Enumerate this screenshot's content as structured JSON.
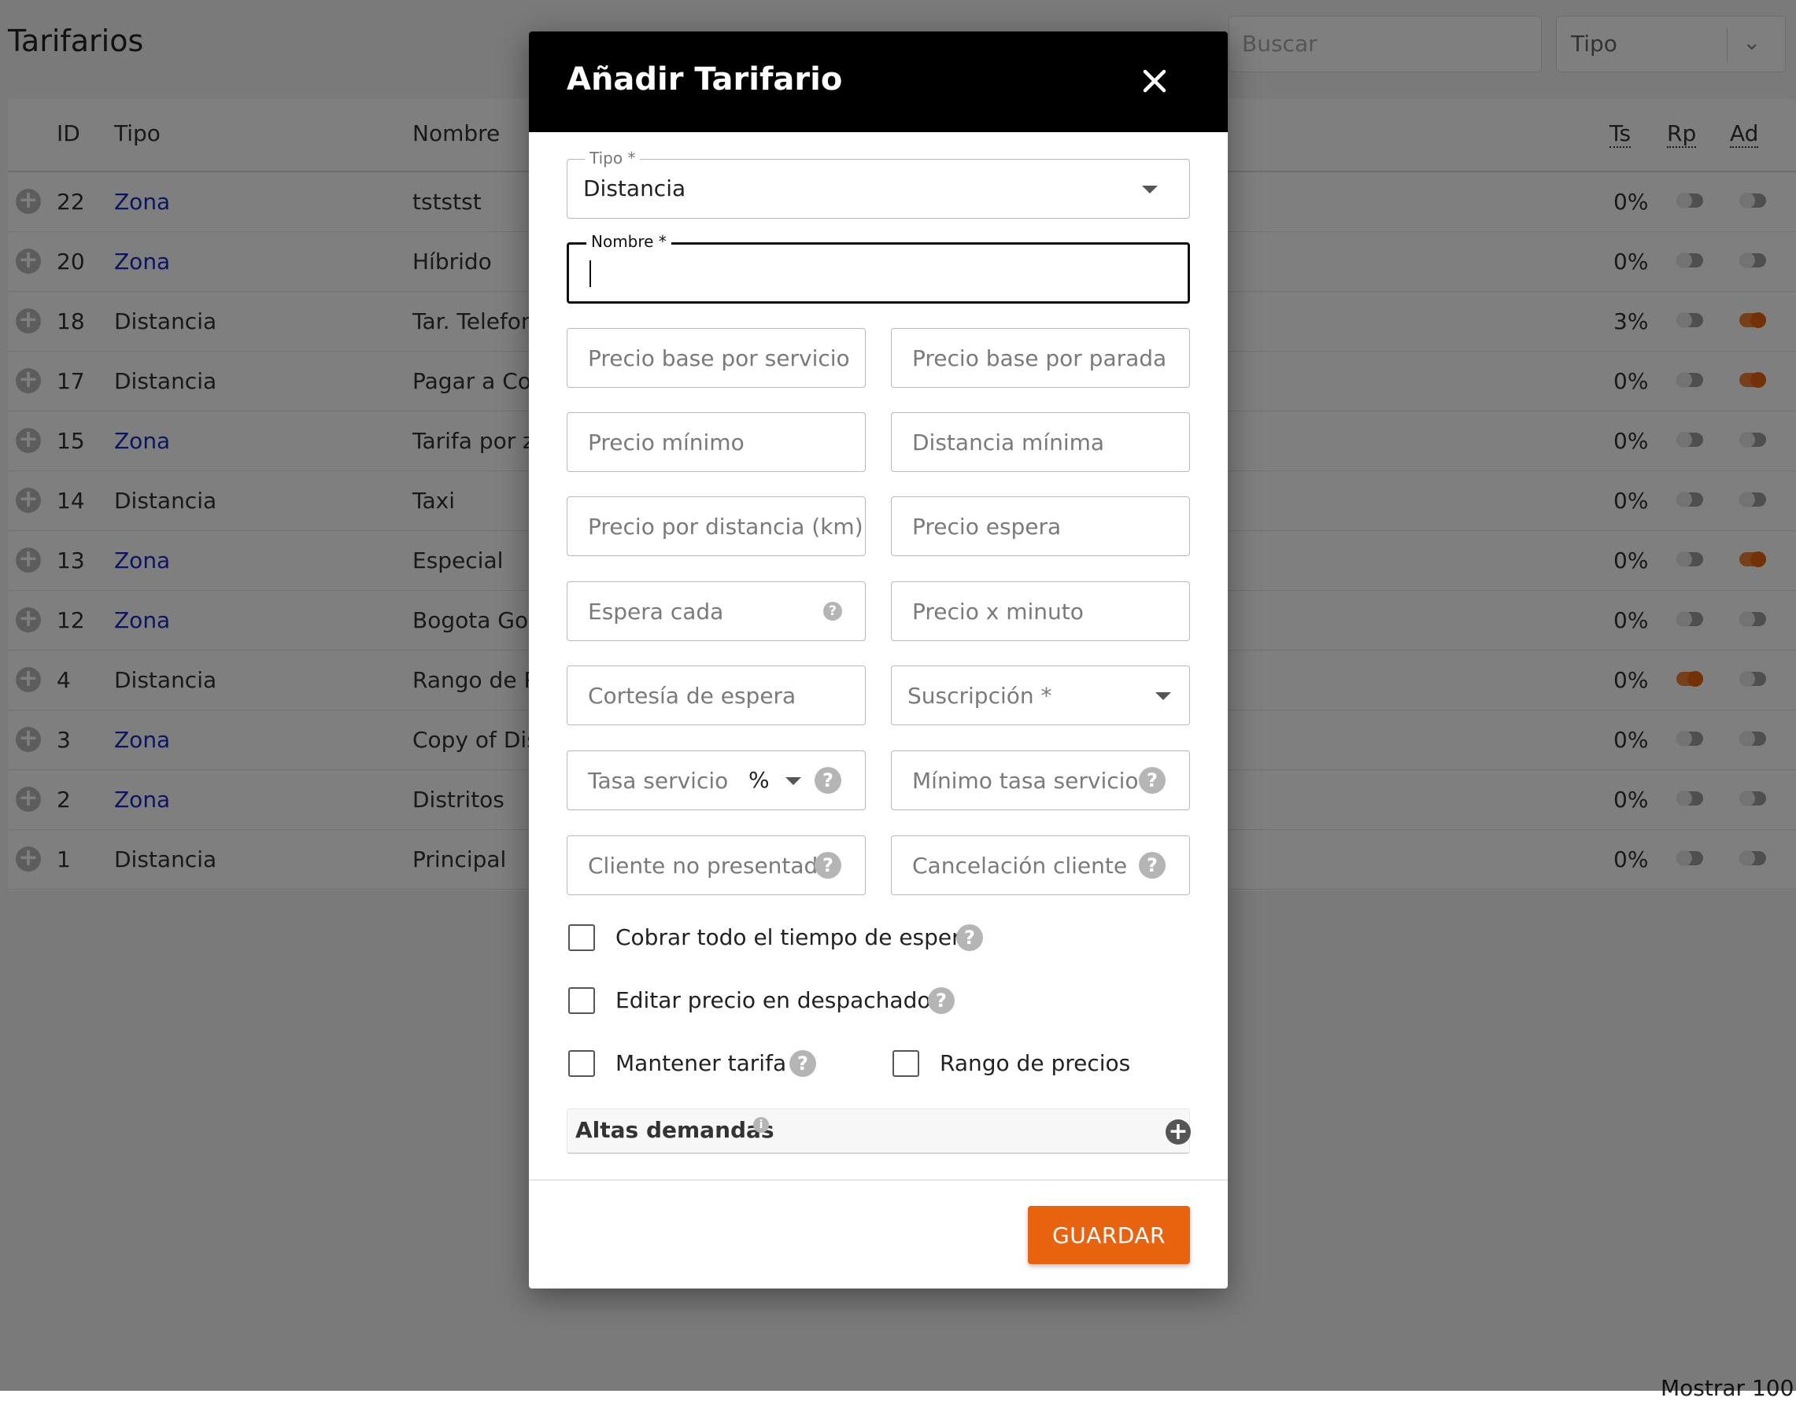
{
  "page": {
    "title": "Tarifarios",
    "search_placeholder": "Buscar",
    "tipo_filter": "Tipo",
    "footer": "Mostrar 100"
  },
  "table": {
    "headers": {
      "id": "ID",
      "tipo": "Tipo",
      "nombre": "Nombre",
      "ts": "Ts",
      "rp": "Rp",
      "ad": "Ad"
    },
    "rows": [
      {
        "id": "22",
        "tipo": "Zona",
        "nombre": "tststst",
        "pct": "0%",
        "rp": false,
        "ad": false
      },
      {
        "id": "20",
        "tipo": "Zona",
        "nombre": "Híbrido",
        "pct": "0%",
        "rp": false,
        "ad": false
      },
      {
        "id": "18",
        "tipo": "Distancia",
        "nombre": "Tar. Telefon",
        "pct": "3%",
        "rp": false,
        "ad": true
      },
      {
        "id": "17",
        "tipo": "Distancia",
        "nombre": "Pagar a Co",
        "pct": "0%",
        "rp": false,
        "ad": true
      },
      {
        "id": "15",
        "tipo": "Zona",
        "nombre": "Tarifa por z",
        "pct": "0%",
        "rp": false,
        "ad": false
      },
      {
        "id": "14",
        "tipo": "Distancia",
        "nombre": "Taxi",
        "pct": "0%",
        "rp": false,
        "ad": false
      },
      {
        "id": "13",
        "tipo": "Zona",
        "nombre": "Especial",
        "pct": "0%",
        "rp": false,
        "ad": true
      },
      {
        "id": "12",
        "tipo": "Zona",
        "nombre": "Bogota Go",
        "pct": "0%",
        "rp": false,
        "ad": false
      },
      {
        "id": "4",
        "tipo": "Distancia",
        "nombre": "Rango de P",
        "pct": "0%",
        "rp": true,
        "ad": false
      },
      {
        "id": "3",
        "tipo": "Zona",
        "nombre": "Copy of Dis",
        "pct": "0%",
        "rp": false,
        "ad": false
      },
      {
        "id": "2",
        "tipo": "Zona",
        "nombre": "Distritos",
        "pct": "0%",
        "rp": false,
        "ad": false
      },
      {
        "id": "1",
        "tipo": "Distancia",
        "nombre": "Principal",
        "pct": "0%",
        "rp": false,
        "ad": false
      }
    ]
  },
  "modal": {
    "title": "Añadir Tarifario",
    "tipo_label": "Tipo *",
    "tipo_value": "Distancia",
    "nombre_label": "Nombre *",
    "nombre_value": "",
    "fields": {
      "precio_base_servicio": "Precio base por servicio",
      "precio_base_parada": "Precio base por parada",
      "precio_minimo": "Precio mínimo",
      "distancia_minima": "Distancia mínima",
      "precio_distancia": "Precio por distancia (km)",
      "precio_espera": "Precio espera",
      "espera_cada": "Espera cada",
      "precio_minuto": "Precio x minuto",
      "cortesia_espera": "Cortesía de espera",
      "suscripcion": "Suscripción *",
      "tasa_servicio": "Tasa servicio",
      "tasa_unit": "%",
      "minimo_tasa": "Mínimo tasa servicio",
      "cliente_no_presentado": "Cliente no presentado",
      "cancelacion_cliente": "Cancelación cliente"
    },
    "checkboxes": {
      "cobrar_espera": "Cobrar todo el tiempo de espera",
      "editar_precio": "Editar precio en despachador",
      "mantener_tarifa": "Mantener tarifa",
      "rango_precios": "Rango de precios"
    },
    "altas_demandas": "Altas demandas",
    "save": "GUARDAR",
    "help_glyph": "?",
    "info_glyph": "i",
    "add_glyph": "+"
  },
  "colors": {
    "accent": "#e8630f",
    "link": "#1a2abf",
    "header_bg": "#000000"
  }
}
